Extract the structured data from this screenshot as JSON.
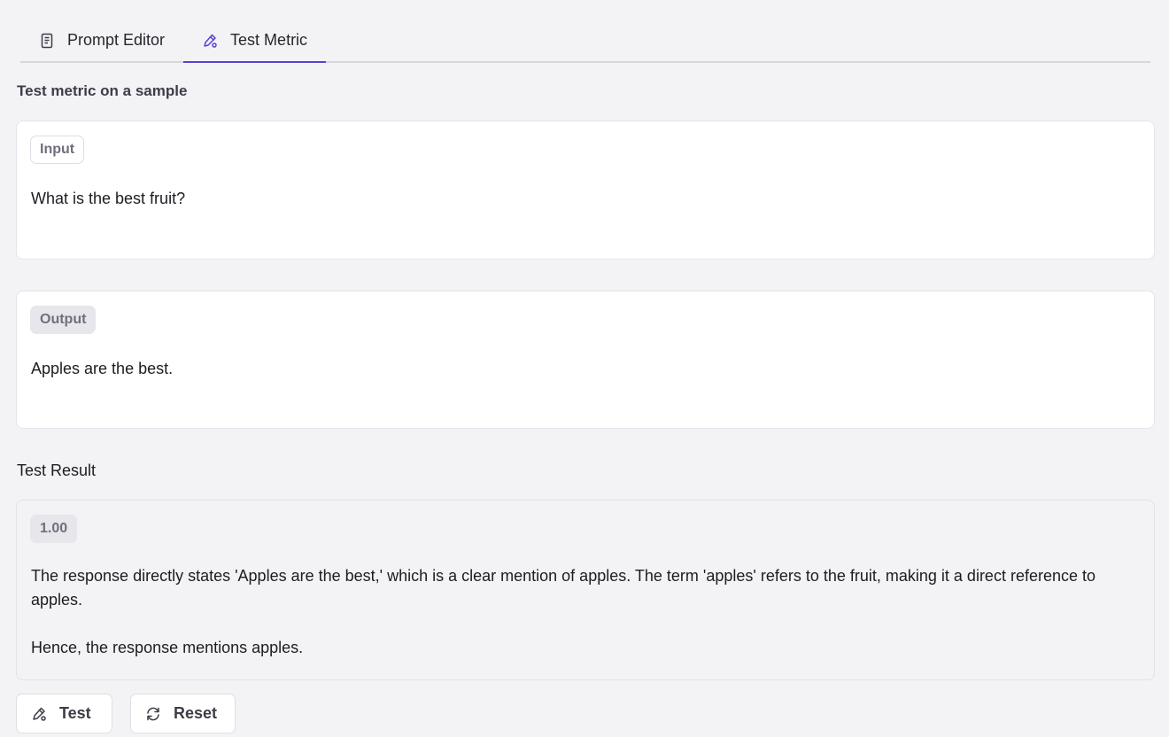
{
  "tabs": [
    {
      "label": "Prompt Editor",
      "icon": "document-icon",
      "active": false
    },
    {
      "label": "Test Metric",
      "icon": "flask-pen-icon",
      "active": true
    }
  ],
  "section_title": "Test metric on a sample",
  "input": {
    "label": "Input",
    "value": "What is the best fruit?"
  },
  "output": {
    "label": "Output",
    "value": "Apples are the best."
  },
  "result": {
    "heading": "Test Result",
    "score": "1.00",
    "explanation": "The response directly states 'Apples are the best,' which is a clear mention of apples. The term 'apples' refers to the fruit, making it a direct reference to apples.",
    "conclusion": "Hence, the response mentions apples."
  },
  "buttons": {
    "test_label": "Test",
    "reset_label": "Reset"
  },
  "colors": {
    "accent": "#5b3fd6",
    "background": "#f3f3f6"
  }
}
